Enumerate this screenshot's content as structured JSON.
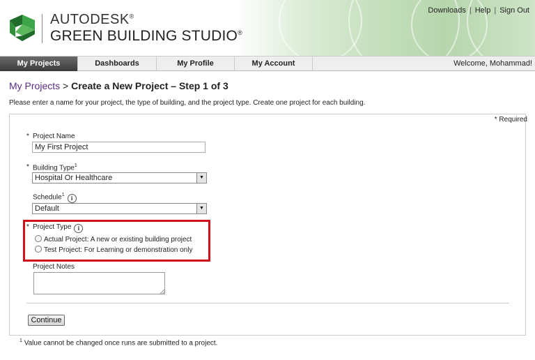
{
  "header": {
    "brand_top": "AUTODESK",
    "brand_product": "GREEN BUILDING STUDIO",
    "registered_mark": "®",
    "links": [
      "Downloads",
      "Help",
      "Sign Out"
    ],
    "link_separator": "|"
  },
  "nav": {
    "tabs": [
      "My Projects",
      "Dashboards",
      "My Profile",
      "My Account"
    ],
    "active_tab": "My Projects",
    "welcome": "Welcome, Mohammad!"
  },
  "page": {
    "breadcrumb_link": "My Projects",
    "breadcrumb_sep": " > ",
    "title": "Create a New Project – Step 1 of 3",
    "instructions": "Please enter a name for your project, the type of building, and the project type. Create one project for each building.",
    "required_note": "* Required"
  },
  "form": {
    "required_star": "*",
    "footnote_mark": "1",
    "info_glyph": "i",
    "project_name": {
      "label": "Project Name",
      "value": "My First Project"
    },
    "building_type": {
      "label": "Building Type",
      "value": "Hospital Or Healthcare"
    },
    "schedule": {
      "label": "Schedule",
      "value": "Default"
    },
    "project_type": {
      "label": "Project Type",
      "options": [
        "Actual Project: A new or existing building project",
        "Test Project: For Learning or demonstration only"
      ]
    },
    "project_notes": {
      "label": "Project Notes",
      "value": ""
    },
    "continue_label": "Continue"
  },
  "footnote": "Value cannot be changed once runs are submitted to a project.",
  "colors": {
    "highlight_box": "#d0111b",
    "nav_active": "#3b3b3b",
    "breadcrumb_link": "#5a2d82",
    "logo_green": "#2f8f3a"
  },
  "icons": [
    "autodesk-logo-icon",
    "info-icon",
    "dropdown-arrow-icon",
    "radio-icon",
    "resize-grip-icon"
  ]
}
